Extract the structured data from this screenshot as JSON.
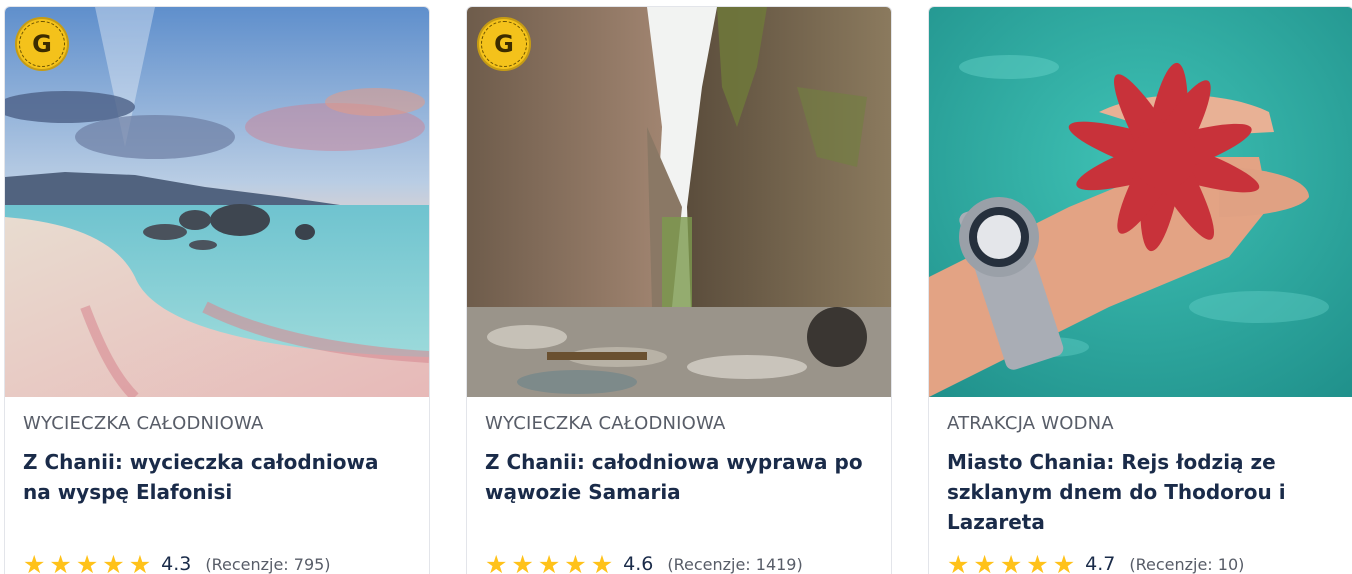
{
  "cards": [
    {
      "badge_letter": "G",
      "category": "WYCIECZKA CAŁODNIOWA",
      "title": "Z Chanii: wycieczka całodniowa na wyspę Elafonisi",
      "rating": "4.3",
      "reviews": "(Recenzje: 795)",
      "image": "beach-pink-sand-sunset"
    },
    {
      "badge_letter": "G",
      "category": "WYCIECZKA CAŁODNIOWA",
      "title": "Z Chanii: całodniowa wyprawa po wąwozie Samaria",
      "rating": "4.6",
      "reviews": "(Recenzje: 1419)",
      "image": "rocky-gorge"
    },
    {
      "category": "ATRAKCJA WODNA",
      "title": "Miasto Chania: Rejs łodzią ze szklanym dnem do Thodorou i Lazareta",
      "rating": "4.7",
      "reviews": "(Recenzje: 10)",
      "image": "hand-with-red-starfish-over-water"
    }
  ],
  "colors": {
    "star": "#ffc21a",
    "title": "#1a2b49",
    "category": "#585d68",
    "badge": "#f4c21b"
  },
  "star_glyph": "★"
}
